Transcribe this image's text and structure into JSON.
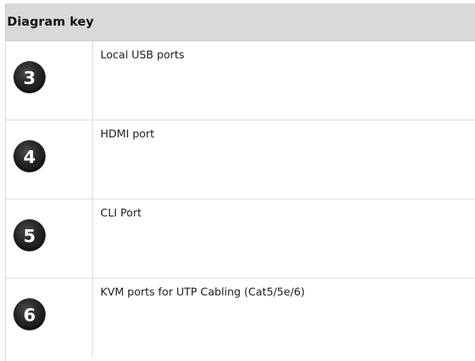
{
  "header": {
    "title": "Diagram key"
  },
  "rows": [
    {
      "number": "3",
      "description": "Local USB ports"
    },
    {
      "number": "4",
      "description": "HDMI port"
    },
    {
      "number": "5",
      "description": "CLI Port"
    },
    {
      "number": "6",
      "description": "KVM ports for UTP Cabling (Cat5/5e/6)"
    }
  ],
  "colors": {
    "header_background": "#d9d9d9",
    "badge_background": "#1c1c1c",
    "badge_text": "#ffffff",
    "grid_line": "#d6d6d6"
  }
}
